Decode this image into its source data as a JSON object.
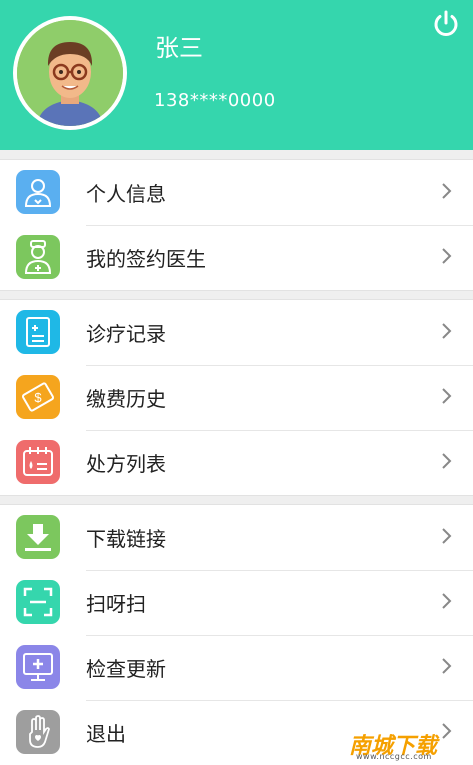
{
  "profile": {
    "name": "张三",
    "phone": "138****0000"
  },
  "header": {
    "power_icon": "power-icon",
    "bg_color": "#35d6ad"
  },
  "groups": [
    {
      "items": [
        {
          "label": "个人信息",
          "icon": "person-icon",
          "color": "#5aaff0"
        },
        {
          "label": "我的签约医生",
          "icon": "doctor-icon",
          "color": "#7cc75e"
        }
      ]
    },
    {
      "items": [
        {
          "label": "诊疗记录",
          "icon": "clipboard-icon",
          "color": "#1fb8e6"
        },
        {
          "label": "缴费历史",
          "icon": "payment-icon",
          "color": "#f5a51e"
        },
        {
          "label": "处方列表",
          "icon": "calendar-icon",
          "color": "#ef6c6c"
        }
      ]
    },
    {
      "items": [
        {
          "label": "下载链接",
          "icon": "download-icon",
          "color": "#7cc75e"
        },
        {
          "label": "扫呀扫",
          "icon": "scan-icon",
          "color": "#35d6ad"
        },
        {
          "label": "检查更新",
          "icon": "monitor-icon",
          "color": "#8b86e8"
        },
        {
          "label": "退出",
          "icon": "hand-icon",
          "color": "#9e9e9e"
        }
      ]
    }
  ],
  "watermark": {
    "text": "南城下载",
    "url": "www.nccgcc.com"
  }
}
